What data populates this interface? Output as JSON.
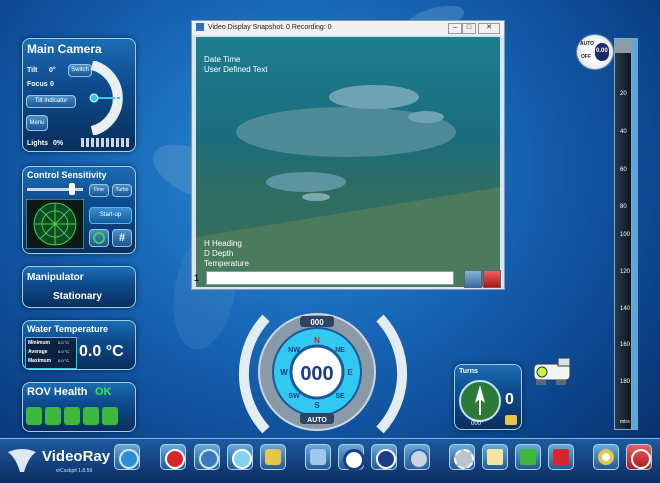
{
  "main_camera": {
    "title": "Main Camera",
    "tilt_label": "Tilt",
    "tilt_value": "0°",
    "focus_label": "Focus",
    "focus_value": "0",
    "switch_label": "Switch",
    "tilt_indicator_label": "Tilt Indicator",
    "menu_label": "Menu",
    "lights_label": "Lights",
    "lights_value": "0%"
  },
  "control_sensitivity": {
    "title": "Control Sensitivity",
    "fine_label": "Fine",
    "turbo_label": "Turbo",
    "startup_label": "Start-up",
    "grid_label": "#"
  },
  "manipulator": {
    "title": "Manipulator",
    "status": "Stationary"
  },
  "water_temperature": {
    "title": "Water Temperature",
    "rows": [
      {
        "label": "Minimum",
        "value": "0.0 °C"
      },
      {
        "label": "Average",
        "value": "0.0 °C"
      },
      {
        "label": "Maximum",
        "value": "0.0 °C"
      }
    ],
    "current": "0.0 °C"
  },
  "rov_health": {
    "title": "ROV Health",
    "status": "OK",
    "status_color": "#39e639"
  },
  "video_window": {
    "title": "Video Display Snapshot: 0 Recording: 0",
    "overlay_top": [
      "Date Time",
      "User Defined Text"
    ],
    "overlay_bottom": [
      "H Heading",
      "D Depth",
      "Temperature"
    ],
    "channel": "1",
    "input_value": ""
  },
  "compass": {
    "heading": "000",
    "top_label": "000",
    "bottom_label": "AUTO",
    "cardinals": [
      "N",
      "NE",
      "E",
      "SE",
      "S",
      "SW",
      "W",
      "NW"
    ]
  },
  "turns": {
    "title": "Turns",
    "value": "0",
    "angle": "000°"
  },
  "depth_gauge": {
    "auto_label": "AUTO",
    "off_label": "OFF",
    "value": "0.00",
    "ticks": [
      "20",
      "40",
      "60",
      "80",
      "100",
      "120",
      "140",
      "160",
      "180"
    ],
    "unit": "mtrs"
  },
  "taskbar": {
    "brand": "VideoRay",
    "version": "vrCockpit 1.8.59"
  },
  "colors": {
    "accent": "#32c8f0",
    "panel_border": "#9fd0f0",
    "alert_red": "#d8262a"
  }
}
